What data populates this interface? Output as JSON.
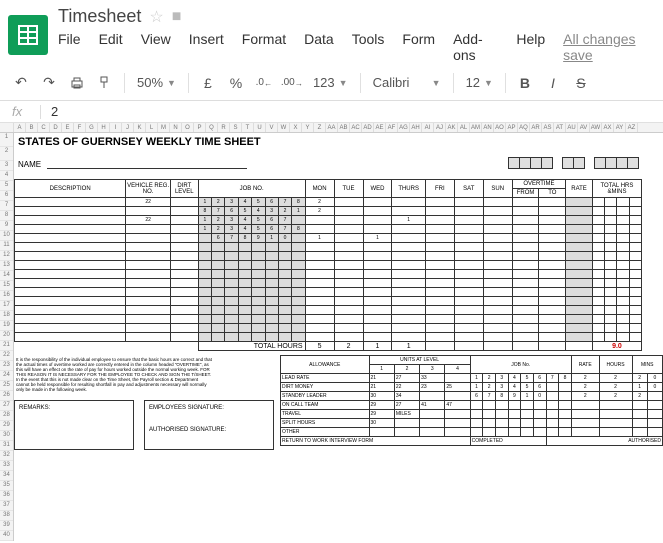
{
  "doc": {
    "title": "Timesheet"
  },
  "menus": [
    "File",
    "Edit",
    "View",
    "Insert",
    "Format",
    "Data",
    "Tools",
    "Form",
    "Add-ons",
    "Help"
  ],
  "allsaved": "All changes save",
  "toolbar": {
    "zoom": "50%",
    "currency": "£",
    "percent": "%",
    "dec_less": ".0←",
    "dec_more": ".00→",
    "num_fmt": "123",
    "font": "Calibri",
    "size": "12",
    "bold": "B",
    "italic": "I",
    "strike": "S"
  },
  "fx": {
    "value": "2"
  },
  "sheet": {
    "title": "STATES OF GUERNSEY WEEKLY TIME SHEET",
    "name_label": "NAME",
    "headers": {
      "desc": "DESCRIPTION",
      "vehicle": "VEHICLE REG. NO.",
      "dirt": "DIRT LEVEL",
      "job": "JOB NO.",
      "days": [
        "MON",
        "TUE",
        "WED",
        "THURS",
        "FRI",
        "SAT",
        "SUN"
      ],
      "ot": "OVERTIME",
      "from": "FROM",
      "to": "TO",
      "rate": "RATE",
      "total": "TOTAL HRS &MINS"
    },
    "rows": [
      {
        "veh": "22",
        "dirt": "",
        "job": [
          "1",
          "2",
          "3",
          "4",
          "5",
          "6",
          "7",
          "8"
        ],
        "mon": "2"
      },
      {
        "veh": "",
        "dirt": "",
        "job": [
          "8",
          "7",
          "6",
          "5",
          "4",
          "3",
          "2",
          "1"
        ],
        "mon": "2"
      },
      {
        "veh": "22",
        "dirt": "",
        "job": [
          "1",
          "2",
          "3",
          "4",
          "5",
          "6",
          "7",
          ""
        ],
        "thurs": "1"
      },
      {
        "veh": "",
        "dirt": "",
        "job": [
          "1",
          "2",
          "3",
          "4",
          "5",
          "6",
          "7",
          "8"
        ]
      },
      {
        "veh": "",
        "dirt": "",
        "job": [
          "",
          "6",
          "7",
          "8",
          "9",
          "1",
          "0",
          ""
        ],
        "mon": "1",
        "wed": "1"
      }
    ],
    "total_hours_label": "TOTAL HOURS",
    "totals": {
      "mon": "5",
      "tue": "2",
      "wed": "1",
      "thurs": "1",
      "grand": "9.0"
    },
    "notes": "It is the responsibility of the individual employee to ensure that the basic hours are correct and that the actual times of overtime worked are correctly entered in the column headed \"OVERTIME\", as this will have an effect on the rate of pay for hours worked outside the normal working week. FOR THIS REASON IT IS NECESSARY FOR THE EMPLOYEE TO CHECK AND SIGN THE T/SHEET.",
    "notes2": "In the event that this is not made clear on the Time Sheet, the Payroll section & Department cannot be held responsible for resulting shortfall in pay and adjustments necessary will normally only be made in the following week.",
    "remarks": "REMARKS:",
    "emp_sig": "EMPLOYEES SIGNATURE:",
    "auth_sig": "AUTHORISED SIGNATURE:",
    "allowance": {
      "title": "ALLOWANCE",
      "units": "UNITS AT LEVEL",
      "levels": [
        "1",
        "2",
        "3",
        "4"
      ],
      "jobno": "JOB No.",
      "rate": "RATE",
      "hours": "HOURS",
      "mins": "MINS",
      "rows": [
        {
          "name": "LEAD RATE",
          "u": [
            "21",
            "27",
            "33",
            ""
          ],
          "job": [
            "1",
            "2",
            "3",
            "4",
            "5",
            "6",
            "7",
            "8"
          ],
          "r": "2",
          "h": "2",
          "m1": "2",
          "m2": "0"
        },
        {
          "name": "DIRT MONEY",
          "u": [
            "21",
            "22",
            "23",
            "25"
          ],
          "job": [
            "1",
            "2",
            "3",
            "4",
            "5",
            "6",
            "",
            ""
          ],
          "r": "2",
          "h": "2",
          "m1": "1",
          "m2": "0"
        },
        {
          "name": "STANDBY LEADER",
          "u": [
            "30",
            "34",
            "",
            ""
          ],
          "job": [
            "6",
            "7",
            "8",
            "9",
            "1",
            "0",
            "",
            ""
          ],
          "r": "2",
          "h": "2",
          "m1": "2",
          "m2": ""
        },
        {
          "name": "ON CALL TEAM",
          "u": [
            "29",
            "27",
            "41",
            "47"
          ]
        },
        {
          "name": "TRAVEL",
          "u": [
            "29",
            "MILES",
            "",
            ""
          ]
        },
        {
          "name": "SPLIT HOURS",
          "u": [
            "30",
            "",
            "",
            ""
          ]
        },
        {
          "name": "OTHER"
        }
      ],
      "return": "RETURN TO WORK INTERVIEW FORM",
      "completed": "COMPLETED",
      "authorised": "AUTHORISED"
    }
  }
}
